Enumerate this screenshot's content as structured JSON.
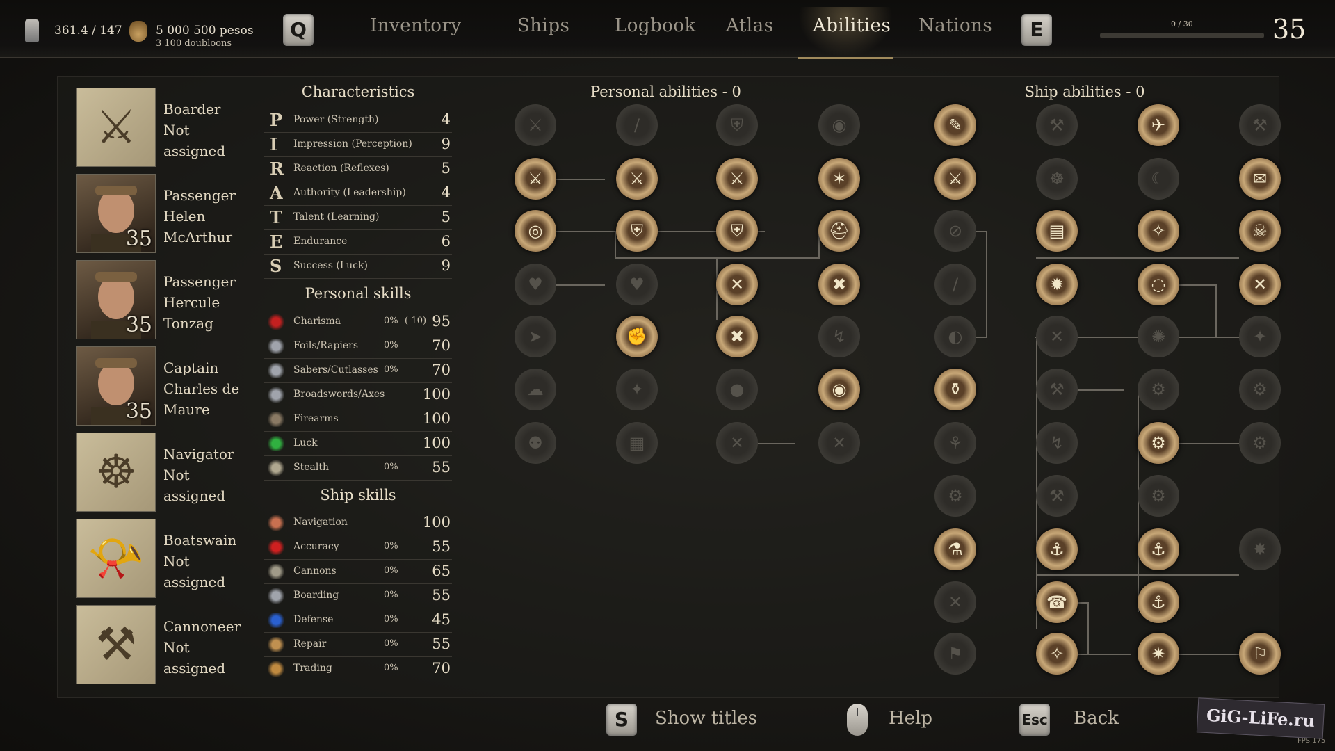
{
  "header": {
    "weight": "361.4 / 147",
    "money": "5 000 500 pesos",
    "doubloons": "3 100 doubloons",
    "prev_key": "Q",
    "next_key": "E",
    "tabs": [
      "Inventory",
      "Ships",
      "Logbook",
      "Atlas",
      "Abilities",
      "Nations"
    ],
    "active_tab": "Abilities",
    "experience": "0 / 30",
    "experience_fraction": 0.0,
    "level": "35"
  },
  "officers": [
    {
      "role": "Boarder",
      "name": "Not assigned",
      "level": "",
      "icon": "crossed-swords-icon",
      "portrait": "empty"
    },
    {
      "role": "Passenger",
      "name": "Helen McArthur",
      "level": "35",
      "icon": "portrait",
      "portrait": "face"
    },
    {
      "role": "Passenger",
      "name": "Hercule Tonzag",
      "level": "35",
      "icon": "portrait",
      "portrait": "face"
    },
    {
      "role": "Captain",
      "name": "Charles de Maure",
      "level": "35",
      "icon": "portrait",
      "portrait": "face"
    },
    {
      "role": "Navigator",
      "name": "Not assigned",
      "level": "",
      "icon": "ship-wheel-icon",
      "portrait": "empty"
    },
    {
      "role": "Boatswain",
      "name": "Not assigned",
      "level": "",
      "icon": "horn-icon",
      "portrait": "empty"
    },
    {
      "role": "Cannoneer",
      "name": "Not assigned",
      "level": "",
      "icon": "cannon-icon",
      "portrait": "empty"
    }
  ],
  "characteristics": {
    "title": "Characteristics",
    "rows": [
      {
        "letter": "P",
        "name": "Power (Strength)",
        "value": "4"
      },
      {
        "letter": "I",
        "name": "Impression (Perception)",
        "value": "9"
      },
      {
        "letter": "R",
        "name": "Reaction (Reflexes)",
        "value": "5"
      },
      {
        "letter": "A",
        "name": "Authority (Leadership)",
        "value": "4"
      },
      {
        "letter": "T",
        "name": "Talent (Learning)",
        "value": "5"
      },
      {
        "letter": "E",
        "name": "Endurance",
        "value": "6"
      },
      {
        "letter": "S",
        "name": "Success (Luck)",
        "value": "9"
      }
    ]
  },
  "personal_skills": {
    "title": "Personal skills",
    "rows": [
      {
        "icon": "flag-icon",
        "name": "Charisma",
        "pct": "0%",
        "mod": "(-10)",
        "value": "95",
        "color": "#c42020"
      },
      {
        "icon": "rapier-icon",
        "name": "Foils/Rapiers",
        "pct": "0%",
        "mod": "",
        "value": "70",
        "color": "#a0a4ac"
      },
      {
        "icon": "saber-icon",
        "name": "Sabers/Cutlasses",
        "pct": "0%",
        "mod": "",
        "value": "70",
        "color": "#a0a4ac"
      },
      {
        "icon": "axe-icon",
        "name": "Broadswords/Axes",
        "pct": "",
        "mod": "",
        "value": "100",
        "color": "#a0a4ac"
      },
      {
        "icon": "pistol-icon",
        "name": "Firearms",
        "pct": "",
        "mod": "",
        "value": "100",
        "color": "#8a7a64"
      },
      {
        "icon": "clover-icon",
        "name": "Luck",
        "pct": "",
        "mod": "",
        "value": "100",
        "color": "#30b040"
      },
      {
        "icon": "mask-icon",
        "name": "Stealth",
        "pct": "0%",
        "mod": "",
        "value": "55",
        "color": "#b0a890"
      }
    ]
  },
  "ship_skills": {
    "title": "Ship skills",
    "rows": [
      {
        "icon": "compass-icon",
        "name": "Navigation",
        "pct": "",
        "mod": "",
        "value": "100",
        "color": "#c87050"
      },
      {
        "icon": "crosshair-icon",
        "name": "Accuracy",
        "pct": "0%",
        "mod": "",
        "value": "55",
        "color": "#d02020"
      },
      {
        "icon": "cannon-icon",
        "name": "Cannons",
        "pct": "0%",
        "mod": "",
        "value": "65",
        "color": "#a09a88"
      },
      {
        "icon": "grapple-icon",
        "name": "Boarding",
        "pct": "0%",
        "mod": "",
        "value": "55",
        "color": "#a0a4ac"
      },
      {
        "icon": "shield-icon",
        "name": "Defense",
        "pct": "0%",
        "mod": "",
        "value": "45",
        "color": "#2a60d0"
      },
      {
        "icon": "hammer-icon",
        "name": "Repair",
        "pct": "0%",
        "mod": "",
        "value": "55",
        "color": "#c09050"
      },
      {
        "icon": "coin-bag-icon",
        "name": "Trading",
        "pct": "0%",
        "mod": "",
        "value": "70",
        "color": "#c08a40"
      }
    ]
  },
  "personal_abilities": {
    "title": "Personal abilities  -  0",
    "nodes": [
      {
        "glyph": "⚔",
        "state": "inactive"
      },
      {
        "glyph": "∕",
        "state": "inactive"
      },
      {
        "glyph": "⛨",
        "state": "inactive"
      },
      {
        "glyph": "◉",
        "state": "inactive"
      },
      {
        "glyph": "⚔",
        "state": "active"
      },
      {
        "glyph": "⚔",
        "state": "active"
      },
      {
        "glyph": "⚔",
        "state": "active"
      },
      {
        "glyph": "✶",
        "state": "active"
      },
      {
        "glyph": "◎",
        "state": "active"
      },
      {
        "glyph": "⛨",
        "state": "active"
      },
      {
        "glyph": "⛨",
        "state": "active"
      },
      {
        "glyph": "⛑",
        "state": "active"
      },
      {
        "glyph": "♥",
        "state": "inactive"
      },
      {
        "glyph": "♥",
        "state": "inactive"
      },
      {
        "glyph": "✕",
        "state": "active"
      },
      {
        "glyph": "✖",
        "state": "active"
      },
      {
        "glyph": "➤",
        "state": "inactive"
      },
      {
        "glyph": "✊",
        "state": "active"
      },
      {
        "glyph": "✖",
        "state": "active"
      },
      {
        "glyph": "↯",
        "state": "inactive"
      },
      {
        "glyph": "☁",
        "state": "inactive"
      },
      {
        "glyph": "✦",
        "state": "inactive"
      },
      {
        "glyph": "●",
        "state": "inactive"
      },
      {
        "glyph": "◉",
        "state": "active"
      },
      {
        "glyph": "⚉",
        "state": "inactive"
      },
      {
        "glyph": "▦",
        "state": "inactive"
      },
      {
        "glyph": "✕",
        "state": "inactive"
      },
      {
        "glyph": "✕",
        "state": "inactive"
      }
    ]
  },
  "ship_abilities": {
    "title": "Ship abilities  -  0",
    "nodes": [
      {
        "glyph": "✎",
        "state": "active"
      },
      {
        "glyph": "⚒",
        "state": "inactive"
      },
      {
        "glyph": "✈",
        "state": "active"
      },
      {
        "glyph": "⚒",
        "state": "inactive"
      },
      {
        "glyph": "⚔",
        "state": "active"
      },
      {
        "glyph": "☸",
        "state": "inactive"
      },
      {
        "glyph": "☾",
        "state": "inactive"
      },
      {
        "glyph": "✉",
        "state": "active"
      },
      {
        "glyph": "⊘",
        "state": "inactive"
      },
      {
        "glyph": "▤",
        "state": "active"
      },
      {
        "glyph": "✧",
        "state": "active"
      },
      {
        "glyph": "☠",
        "state": "active"
      },
      {
        "glyph": "∕",
        "state": "inactive"
      },
      {
        "glyph": "✹",
        "state": "active"
      },
      {
        "glyph": "◌",
        "state": "active"
      },
      {
        "glyph": "✕",
        "state": "active"
      },
      {
        "glyph": "◐",
        "state": "inactive"
      },
      {
        "glyph": "✕",
        "state": "inactive"
      },
      {
        "glyph": "✺",
        "state": "inactive"
      },
      {
        "glyph": "✦",
        "state": "inactive"
      },
      {
        "glyph": "⚱",
        "state": "active"
      },
      {
        "glyph": "⚒",
        "state": "inactive"
      },
      {
        "glyph": "⚙",
        "state": "inactive"
      },
      {
        "glyph": "⚙",
        "state": "inactive"
      },
      {
        "glyph": "⚘",
        "state": "inactive"
      },
      {
        "glyph": "↯",
        "state": "inactive"
      },
      {
        "glyph": "⚙",
        "state": "active"
      },
      {
        "glyph": "⚙",
        "state": "inactive"
      },
      {
        "glyph": "⚙",
        "state": "inactive"
      },
      {
        "glyph": "⚒",
        "state": "inactive"
      },
      {
        "glyph": "⚙",
        "state": "inactive"
      },
      {
        "glyph": "⚗",
        "state": "active"
      },
      {
        "glyph": "⚓",
        "state": "active"
      },
      {
        "glyph": "⚓",
        "state": "active"
      },
      {
        "glyph": "✸",
        "state": "inactive"
      },
      {
        "glyph": "✕",
        "state": "inactive"
      },
      {
        "glyph": "☎",
        "state": "active"
      },
      {
        "glyph": "⚓",
        "state": "active"
      },
      {
        "glyph": "⚑",
        "state": "inactive"
      },
      {
        "glyph": "✧",
        "state": "active"
      },
      {
        "glyph": "✷",
        "state": "active"
      },
      {
        "glyph": "⚐",
        "state": "active"
      }
    ]
  },
  "footer": {
    "show_titles_key": "S",
    "show_titles": "Show titles",
    "help": "Help",
    "back_key": "Esc",
    "back": "Back",
    "watermark": "GiG-LiFe.ru",
    "fps": "FPS 175"
  }
}
